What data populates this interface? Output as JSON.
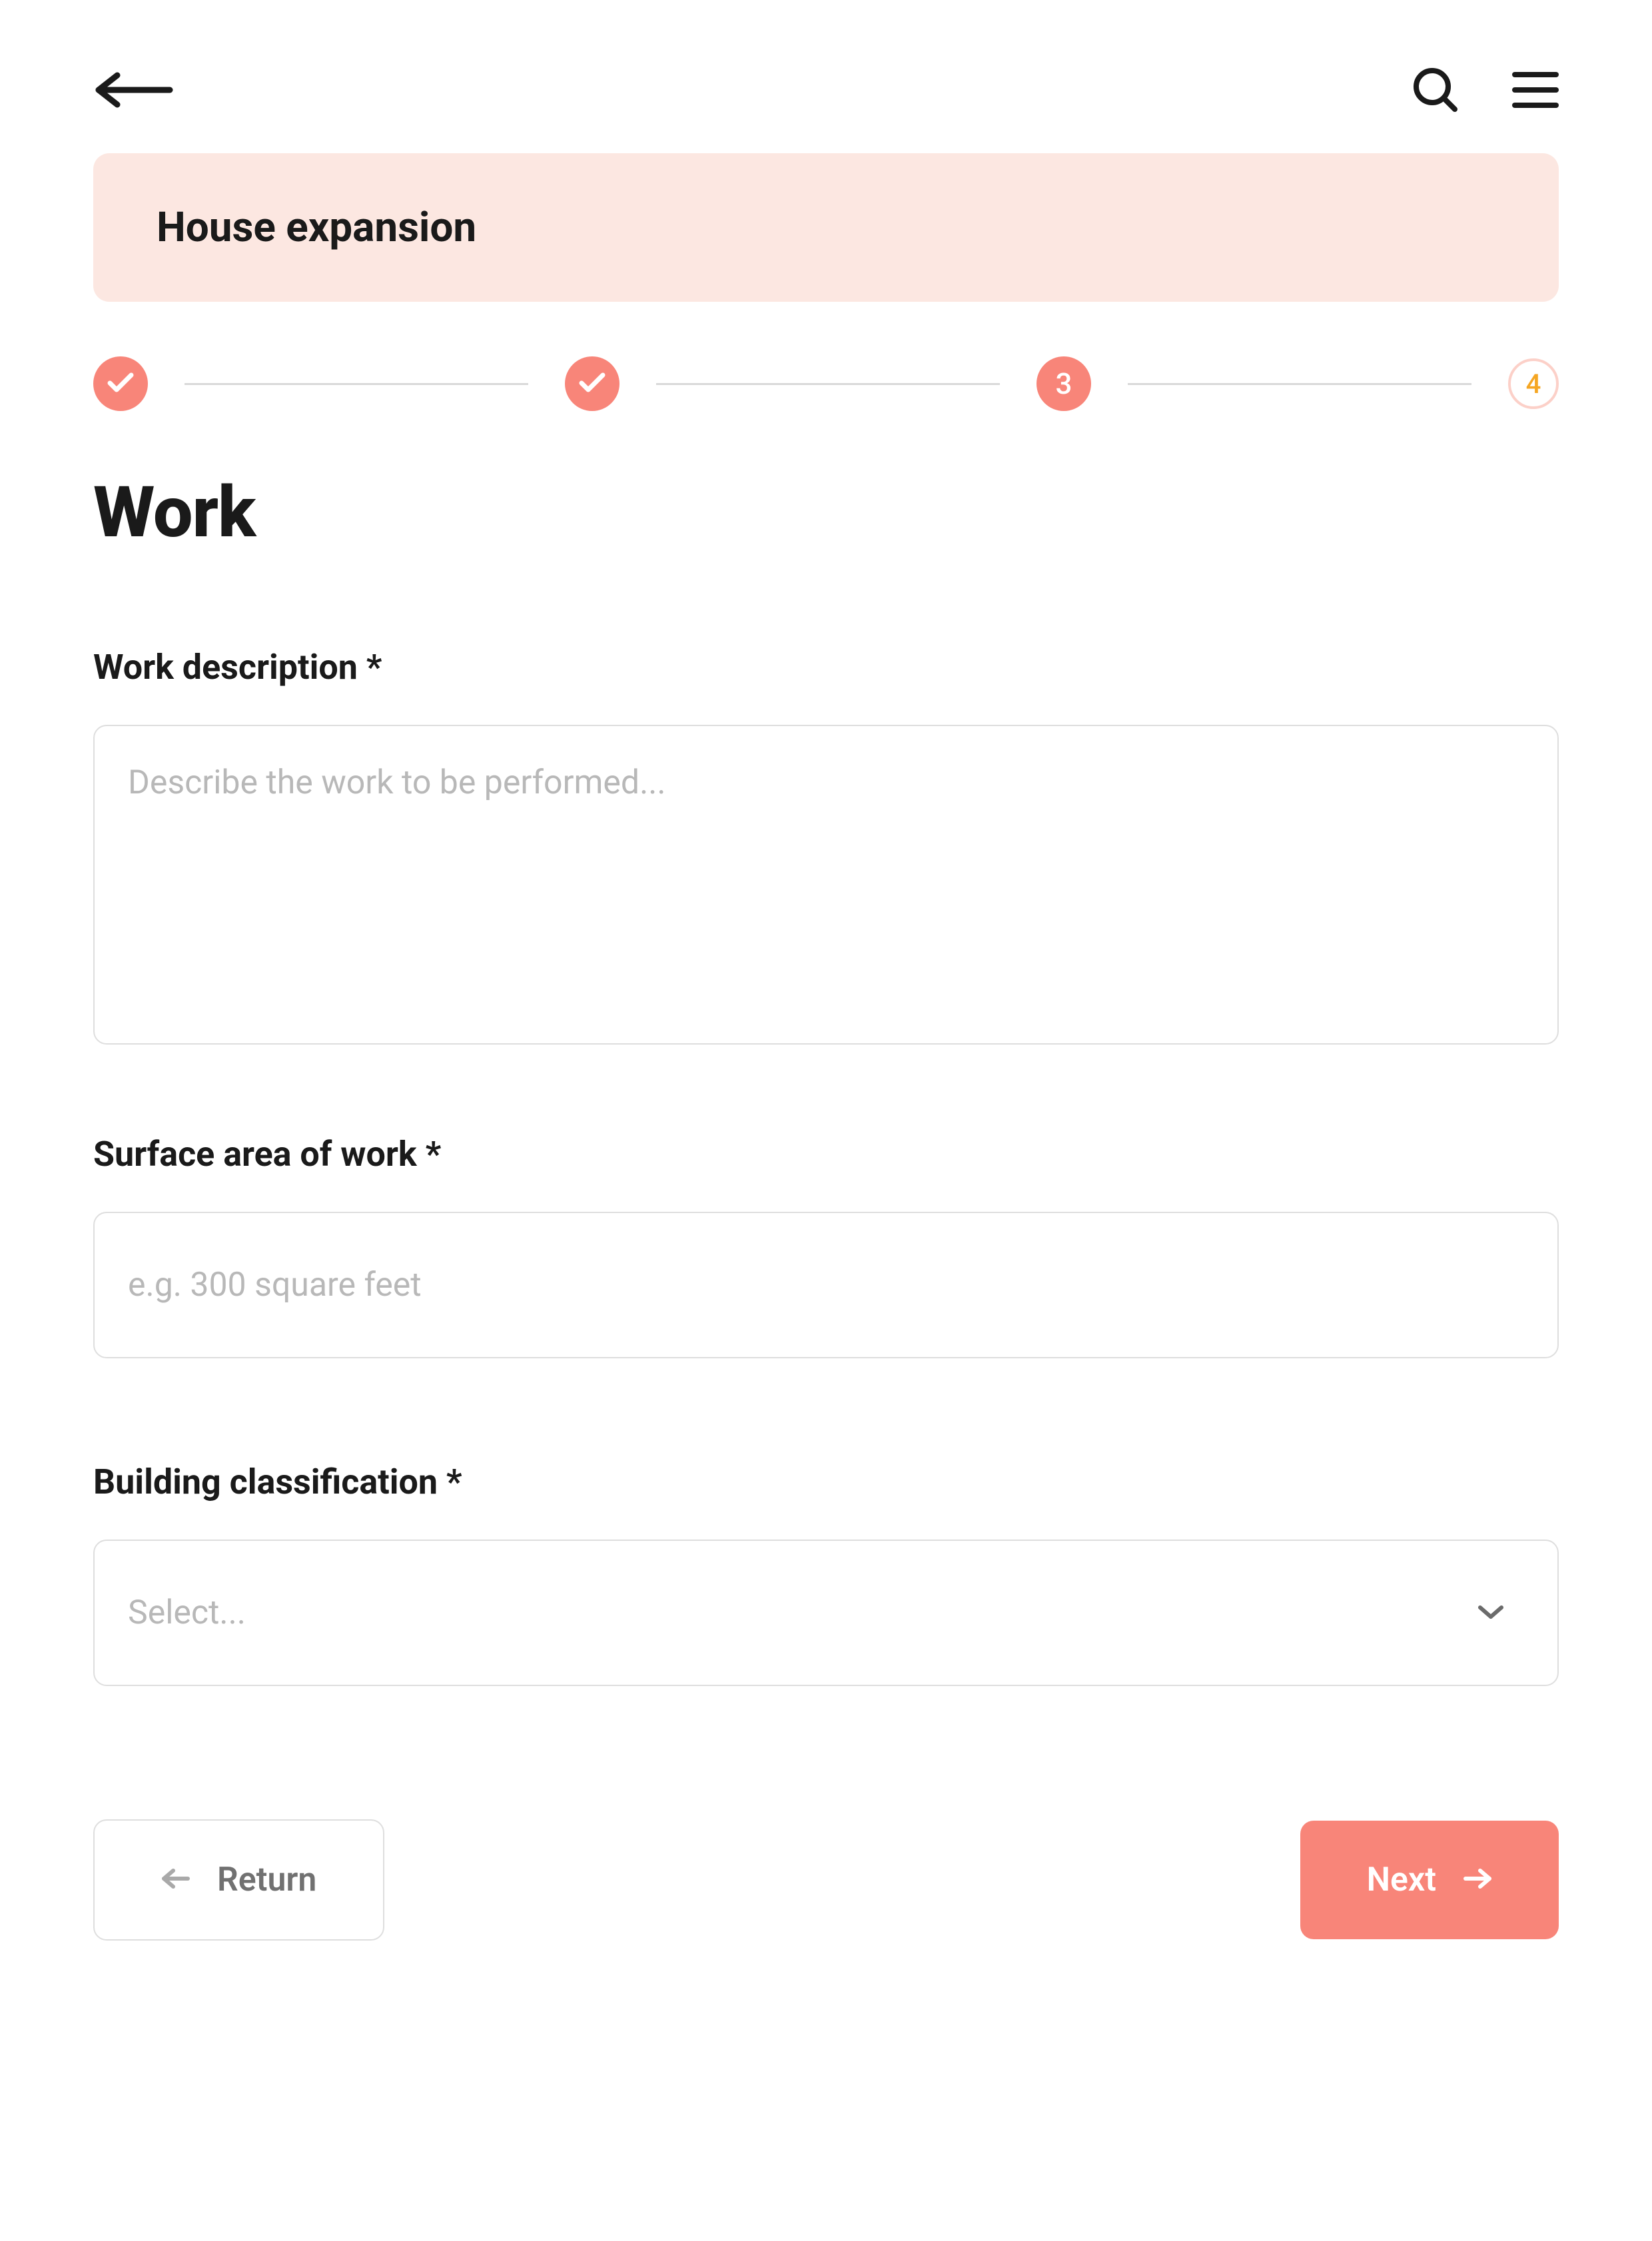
{
  "banner": {
    "title": "House expansion"
  },
  "stepper": {
    "steps": [
      {
        "state": "done"
      },
      {
        "state": "done"
      },
      {
        "state": "current",
        "label": "3"
      },
      {
        "state": "upcoming",
        "label": "4"
      }
    ]
  },
  "page": {
    "title": "Work"
  },
  "form": {
    "work_description": {
      "label": "Work description *",
      "placeholder": "Describe the work to be performed..."
    },
    "surface_area": {
      "label": "Surface area of work *",
      "placeholder": "e.g. 300 square feet"
    },
    "building_classification": {
      "label": "Building classification *",
      "placeholder": "Select..."
    }
  },
  "actions": {
    "return": "Return",
    "next": "Next"
  }
}
